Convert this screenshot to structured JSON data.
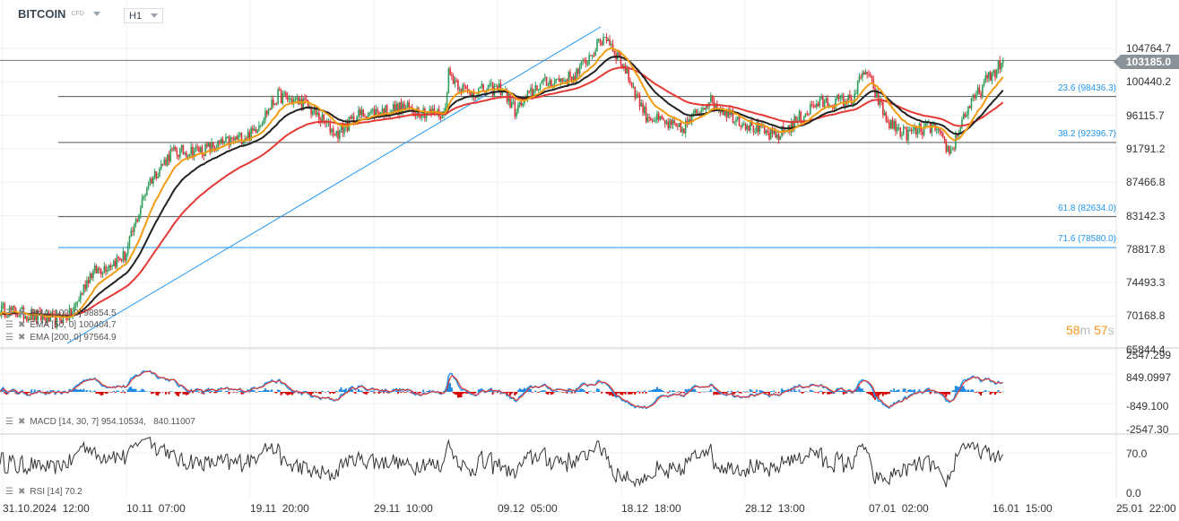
{
  "header": {
    "symbol": "BITCOIN",
    "type": "CFD",
    "timeframe": "H1"
  },
  "price_axis": [
    "104764.7",
    "100440.2",
    "96115.7",
    "91791.2",
    "87466.8",
    "83142.3",
    "78817.8",
    "74493.3",
    "70168.8",
    "65844.4"
  ],
  "current_price": "103185.0",
  "timer": {
    "m": "58",
    "m_unit": "m",
    "s": "57",
    "s_unit": "s"
  },
  "fib_levels": [
    {
      "label": "23.6 (98436.3)",
      "price": 98436.3
    },
    {
      "label": "38.2 (92396.7)",
      "price": 92396.7
    },
    {
      "label": "61.8 (82634.0)",
      "price": 82634.0
    },
    {
      "label": "71.6 (78580.0)",
      "price": 78580.0
    }
  ],
  "legends": {
    "ema100": "EMA [100, 0] 98854.5",
    "ema50": "EMA [50, 0] 100404.7",
    "ema200": "EMA [200, 0] 97564.9",
    "macd": "MACD [14, 30, 7] 954.10534,   840.11007",
    "rsi": "RSI [14] 70.2"
  },
  "macd_axis": [
    "2547.299",
    "849.0997",
    "-849.100",
    "-2547.30"
  ],
  "rsi_axis": [
    "70.0",
    "0.0"
  ],
  "time_axis": [
    "31.10.2024  12:00",
    "10.11  07:00",
    "19.11  20:00",
    "29.11  10:00",
    "09.12  05:00",
    "18.12  18:00",
    "28.12  13:00",
    "07.01  02:00",
    "16.01  15:00",
    "25.01  22:00"
  ],
  "colors": {
    "up": "#2e9e5b",
    "down": "#e0303a",
    "ema_fast": "#f39c12",
    "ema_mid": "#222222",
    "ema_slow": "#e53935",
    "fib": "#2196f3"
  },
  "chart_data": {
    "type": "candlestick",
    "hours_total": 2120,
    "ylim": [
      65844.4,
      104764.7
    ],
    "keypoints": [
      [
        0,
        70500
      ],
      [
        102,
        69000
      ],
      [
        136,
        69800
      ],
      [
        170,
        75000
      ],
      [
        238,
        77500
      ],
      [
        281,
        87000
      ],
      [
        324,
        91000
      ],
      [
        392,
        91500
      ],
      [
        477,
        93500
      ],
      [
        528,
        98500
      ],
      [
        579,
        97500
      ],
      [
        639,
        93500
      ],
      [
        681,
        96000
      ],
      [
        766,
        97000
      ],
      [
        843,
        96000
      ],
      [
        852,
        101500
      ],
      [
        886,
        99000
      ],
      [
        954,
        99500
      ],
      [
        979,
        96500
      ],
      [
        1022,
        100000
      ],
      [
        1090,
        101000
      ],
      [
        1150,
        106500
      ],
      [
        1184,
        102500
      ],
      [
        1226,
        96000
      ],
      [
        1294,
        94000
      ],
      [
        1345,
        98000
      ],
      [
        1413,
        95000
      ],
      [
        1473,
        93000
      ],
      [
        1499,
        94500
      ],
      [
        1550,
        97500
      ],
      [
        1618,
        98000
      ],
      [
        1643,
        102000
      ],
      [
        1686,
        95000
      ],
      [
        1720,
        93500
      ],
      [
        1771,
        94500
      ],
      [
        1805,
        91000
      ],
      [
        1831,
        96000
      ],
      [
        1873,
        100500
      ],
      [
        1907,
        103185
      ]
    ]
  }
}
